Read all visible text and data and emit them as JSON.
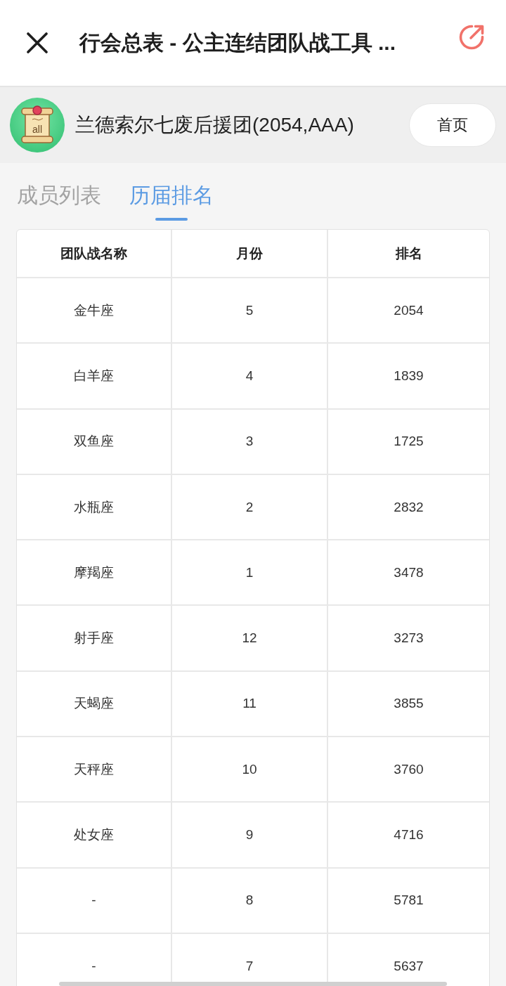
{
  "window": {
    "title": "行会总表 - 公主连结团队战工具 ..."
  },
  "guild": {
    "avatar_label": "all",
    "name": "兰德索尔七废后援团(2054,AAA)",
    "home_button": "首页"
  },
  "tabs": [
    {
      "label": "成员列表",
      "selected": false
    },
    {
      "label": "历届排名",
      "selected": true
    }
  ],
  "table": {
    "columns": [
      "团队战名称",
      "月份",
      "排名"
    ],
    "rows": [
      [
        "金牛座",
        "5",
        "2054"
      ],
      [
        "白羊座",
        "4",
        "1839"
      ],
      [
        "双鱼座",
        "3",
        "1725"
      ],
      [
        "水瓶座",
        "2",
        "2832"
      ],
      [
        "摩羯座",
        "1",
        "3478"
      ],
      [
        "射手座",
        "12",
        "3273"
      ],
      [
        "天蝎座",
        "11",
        "3855"
      ],
      [
        "天秤座",
        "10",
        "3760"
      ],
      [
        "处女座",
        "9",
        "4716"
      ],
      [
        "-",
        "8",
        "5781"
      ],
      [
        "-",
        "7",
        "5637"
      ]
    ]
  }
}
